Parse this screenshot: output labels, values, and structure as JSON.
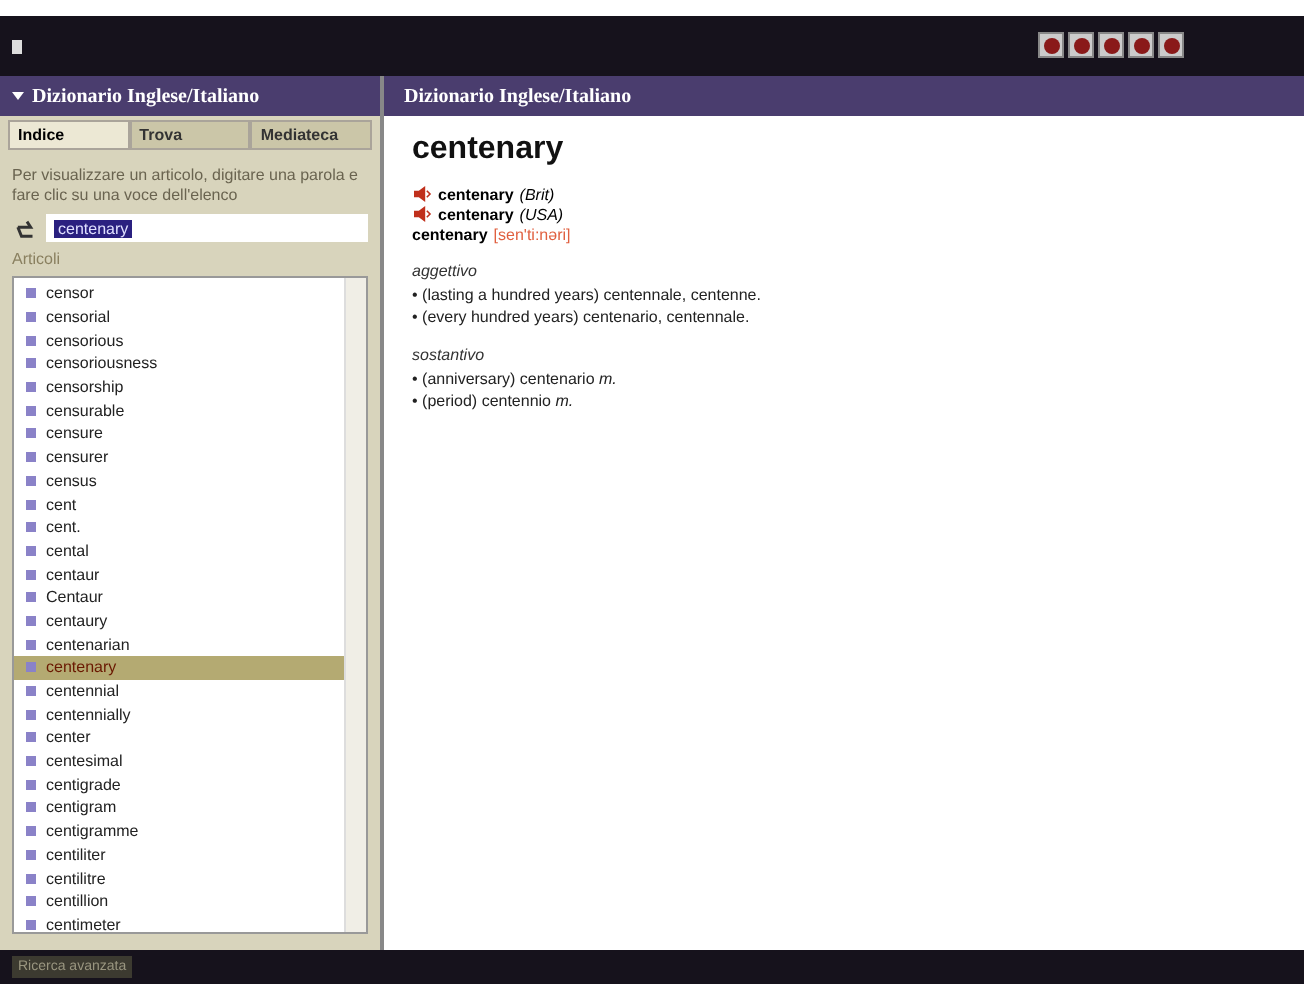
{
  "left_panel": {
    "title": "Dizionario Inglese/Italiano",
    "tabs": [
      {
        "label": "Indice",
        "selected": true
      },
      {
        "label": "Trova",
        "selected": false
      },
      {
        "label": "Mediateca",
        "selected": false
      }
    ],
    "instructions": "Per visualizzare un articolo, digitare una parola e fare clic su una voce dell'elenco",
    "search": {
      "value": "centenary"
    },
    "list_label": "Articoli",
    "items": [
      {
        "label": "censor",
        "selected": false
      },
      {
        "label": "censorial",
        "selected": false
      },
      {
        "label": "censorious",
        "selected": false
      },
      {
        "label": "censoriousness",
        "selected": false
      },
      {
        "label": "censorship",
        "selected": false
      },
      {
        "label": "censurable",
        "selected": false
      },
      {
        "label": "censure",
        "selected": false
      },
      {
        "label": "censurer",
        "selected": false
      },
      {
        "label": "census",
        "selected": false
      },
      {
        "label": "cent",
        "selected": false
      },
      {
        "label": "cent.",
        "selected": false
      },
      {
        "label": "cental",
        "selected": false
      },
      {
        "label": "centaur",
        "selected": false
      },
      {
        "label": "Centaur",
        "selected": false
      },
      {
        "label": "centaury",
        "selected": false
      },
      {
        "label": "centenarian",
        "selected": false
      },
      {
        "label": "centenary",
        "selected": true
      },
      {
        "label": "centennial",
        "selected": false
      },
      {
        "label": "centennially",
        "selected": false
      },
      {
        "label": "center",
        "selected": false
      },
      {
        "label": "centesimal",
        "selected": false
      },
      {
        "label": "centigrade",
        "selected": false
      },
      {
        "label": "centigram",
        "selected": false
      },
      {
        "label": "centigramme",
        "selected": false
      },
      {
        "label": "centiliter",
        "selected": false
      },
      {
        "label": "centilitre",
        "selected": false
      },
      {
        "label": "centillion",
        "selected": false
      },
      {
        "label": "centimeter",
        "selected": false
      }
    ]
  },
  "article": {
    "header": "Dizionario Inglese/Italiano",
    "headword": "centenary",
    "pronunciations": [
      {
        "kind": "audio",
        "word": "centenary",
        "note": "(Brit)"
      },
      {
        "kind": "audio",
        "word": "centenary",
        "note": "(USA)"
      },
      {
        "kind": "phonetic",
        "word": "centenary",
        "note": "[sen'ti:nəri]"
      }
    ],
    "sections": [
      {
        "pos": "aggettivo",
        "senses": [
          "• (lasting a hundred years) centennale, centenne.",
          "• (every hundred years) centenario, centennale."
        ]
      },
      {
        "pos": "sostantivo",
        "senses": [
          "• (anniversary) centenario *m.*",
          "• (period) centennio *m.*"
        ]
      }
    ]
  },
  "status_bar": {
    "left": "Ricerca avanzata"
  }
}
